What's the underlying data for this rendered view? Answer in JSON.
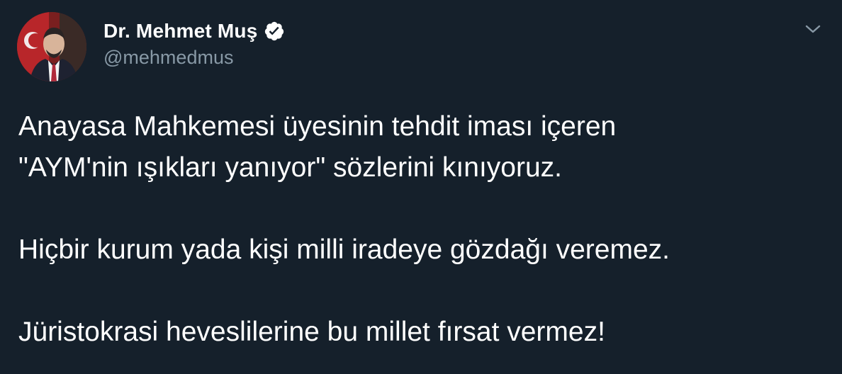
{
  "author": {
    "display_name": "Dr. Mehmet Muş",
    "handle": "@mehmedmus",
    "verified": true
  },
  "tweet": {
    "paragraphs": [
      [
        "Anayasa Mahkemesi üyesinin tehdit iması içeren",
        "\"AYM'nin ışıkları yanıyor\" sözlerini kınıyoruz."
      ],
      [
        "Hiçbir kurum yada kişi milli iradeye gözdağı veremez."
      ],
      [
        "Jüristokrasi heveslilerine bu millet fırsat vermez!"
      ]
    ]
  },
  "icons": {
    "avatar": "profile-photo",
    "verified": "verified-badge-icon",
    "menu": "chevron-down-icon"
  },
  "colors": {
    "background": "#15202b",
    "text_primary": "#ffffff",
    "text_secondary": "#8899a6",
    "verified_badge": "#ffffff"
  }
}
